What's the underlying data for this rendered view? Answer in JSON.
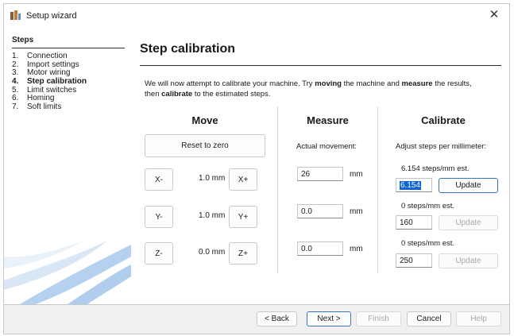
{
  "window": {
    "title": "Setup wizard",
    "close_glyph": "✕",
    "app_icon": "universal-gcode-sender-icon"
  },
  "sidebar": {
    "heading": "Steps",
    "items": [
      {
        "num": "1.",
        "label": "Connection"
      },
      {
        "num": "2.",
        "label": "Import settings"
      },
      {
        "num": "3.",
        "label": "Motor wiring"
      },
      {
        "num": "4.",
        "label": "Step calibration"
      },
      {
        "num": "5.",
        "label": "Limit switches"
      },
      {
        "num": "6.",
        "label": "Homing"
      },
      {
        "num": "7.",
        "label": "Soft limits"
      }
    ],
    "active_index": 3
  },
  "main": {
    "title": "Step calibration",
    "intro": {
      "p1": "We will now attempt to calibrate your machine. Try ",
      "b1": "moving",
      "p2": " the machine and ",
      "b2": "measure",
      "p3": " the results,",
      "p4": "then ",
      "b3": "calibrate",
      "p5": " to the estimated steps."
    },
    "move": {
      "heading": "Move",
      "reset_label": "Reset to zero",
      "axes": [
        {
          "minus": "X-",
          "step": "1.0 mm",
          "plus": "X+"
        },
        {
          "minus": "Y-",
          "step": "1.0 mm",
          "plus": "Y+"
        },
        {
          "minus": "Z-",
          "step": "0.0 mm",
          "plus": "Z+"
        }
      ]
    },
    "measure": {
      "heading": "Measure",
      "caption": "Actual movement:",
      "unit": "mm",
      "values": [
        "26",
        "0.0",
        "0.0"
      ]
    },
    "calibrate": {
      "heading": "Calibrate",
      "caption": "Adjust steps per millimeter:",
      "rows": [
        {
          "estimate": "6.154 steps/mm est.",
          "value": "6.154",
          "update": "Update",
          "enabled": true
        },
        {
          "estimate": "0 steps/mm est.",
          "value": "160",
          "update": "Update",
          "enabled": false
        },
        {
          "estimate": "0 steps/mm est.",
          "value": "250",
          "update": "Update",
          "enabled": false
        }
      ]
    }
  },
  "footer": {
    "back": "< Back",
    "next": "Next >",
    "finish": "Finish",
    "cancel": "Cancel",
    "help": "Help"
  },
  "colors": {
    "accent": "#3a76c6",
    "selection": "#0a64d6",
    "swoosh": "#9fc2e8"
  }
}
